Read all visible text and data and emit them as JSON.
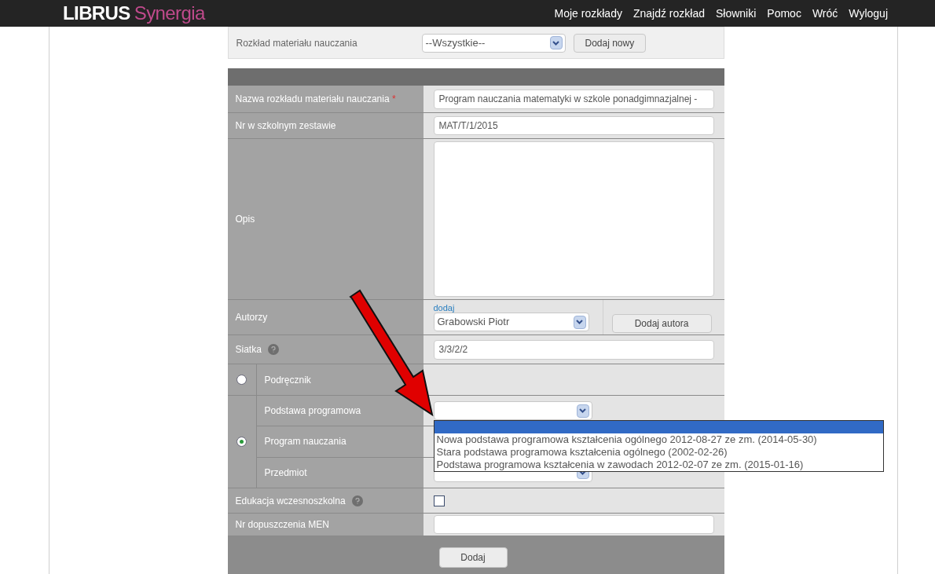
{
  "header": {
    "logo": {
      "brand": "LIBRUS",
      "product": "Synergia"
    },
    "nav": [
      "Moje rozkłady",
      "Znajdź rozkład",
      "Słowniki",
      "Pomoc",
      "Wróć",
      "Wyloguj"
    ]
  },
  "filter": {
    "label": "Rozkład materiału nauczania",
    "value": "--Wszystkie--",
    "button": "Dodaj nowy"
  },
  "form": {
    "name": {
      "label": "Nazwa rozkładu materiału nauczania",
      "required_mark": "*",
      "value": "Program nauczania matematyki w szkole ponadgimnazjalnej -"
    },
    "number": {
      "label": "Nr w szkolnym zestawie",
      "value": "MAT/T/1/2015"
    },
    "description": {
      "label": "Opis"
    },
    "authors": {
      "label": "Autorzy",
      "link": "dodaj",
      "value": "Grabowski Piotr",
      "button": "Dodaj autora"
    },
    "grid": {
      "label": "Siatka",
      "value": "3/3/2/2"
    },
    "textbook": {
      "label": "Podręcznik",
      "selected": false
    },
    "program": {
      "selected": true,
      "rows": [
        {
          "label": "Podstawa programowa",
          "kind": "open-select"
        },
        {
          "label": "Program nauczania",
          "kind": "empty"
        },
        {
          "label": "Przedmiot",
          "kind": "select-button"
        }
      ]
    },
    "early_education": {
      "label": "Edukacja wczesnoszkolna",
      "checked": false
    },
    "men_number": {
      "label": "Nr dopuszczenia MEN"
    },
    "submit": "Dodaj"
  },
  "dropdown": {
    "options": [
      {
        "selected": true
      },
      {
        "label": "Nowa podstawa programowa kształcenia ogólnego 2012-08-27 ze zm. (2014-05-30)",
        "selected": false
      },
      {
        "label": "Stara podstawa programowa kształcenia ogólnego (2002-02-26)",
        "selected": false
      },
      {
        "label": "Podstawa programowa kształcenia w zawodach 2012-02-07 ze zm. (2015-01-16)",
        "selected": false
      }
    ]
  }
}
